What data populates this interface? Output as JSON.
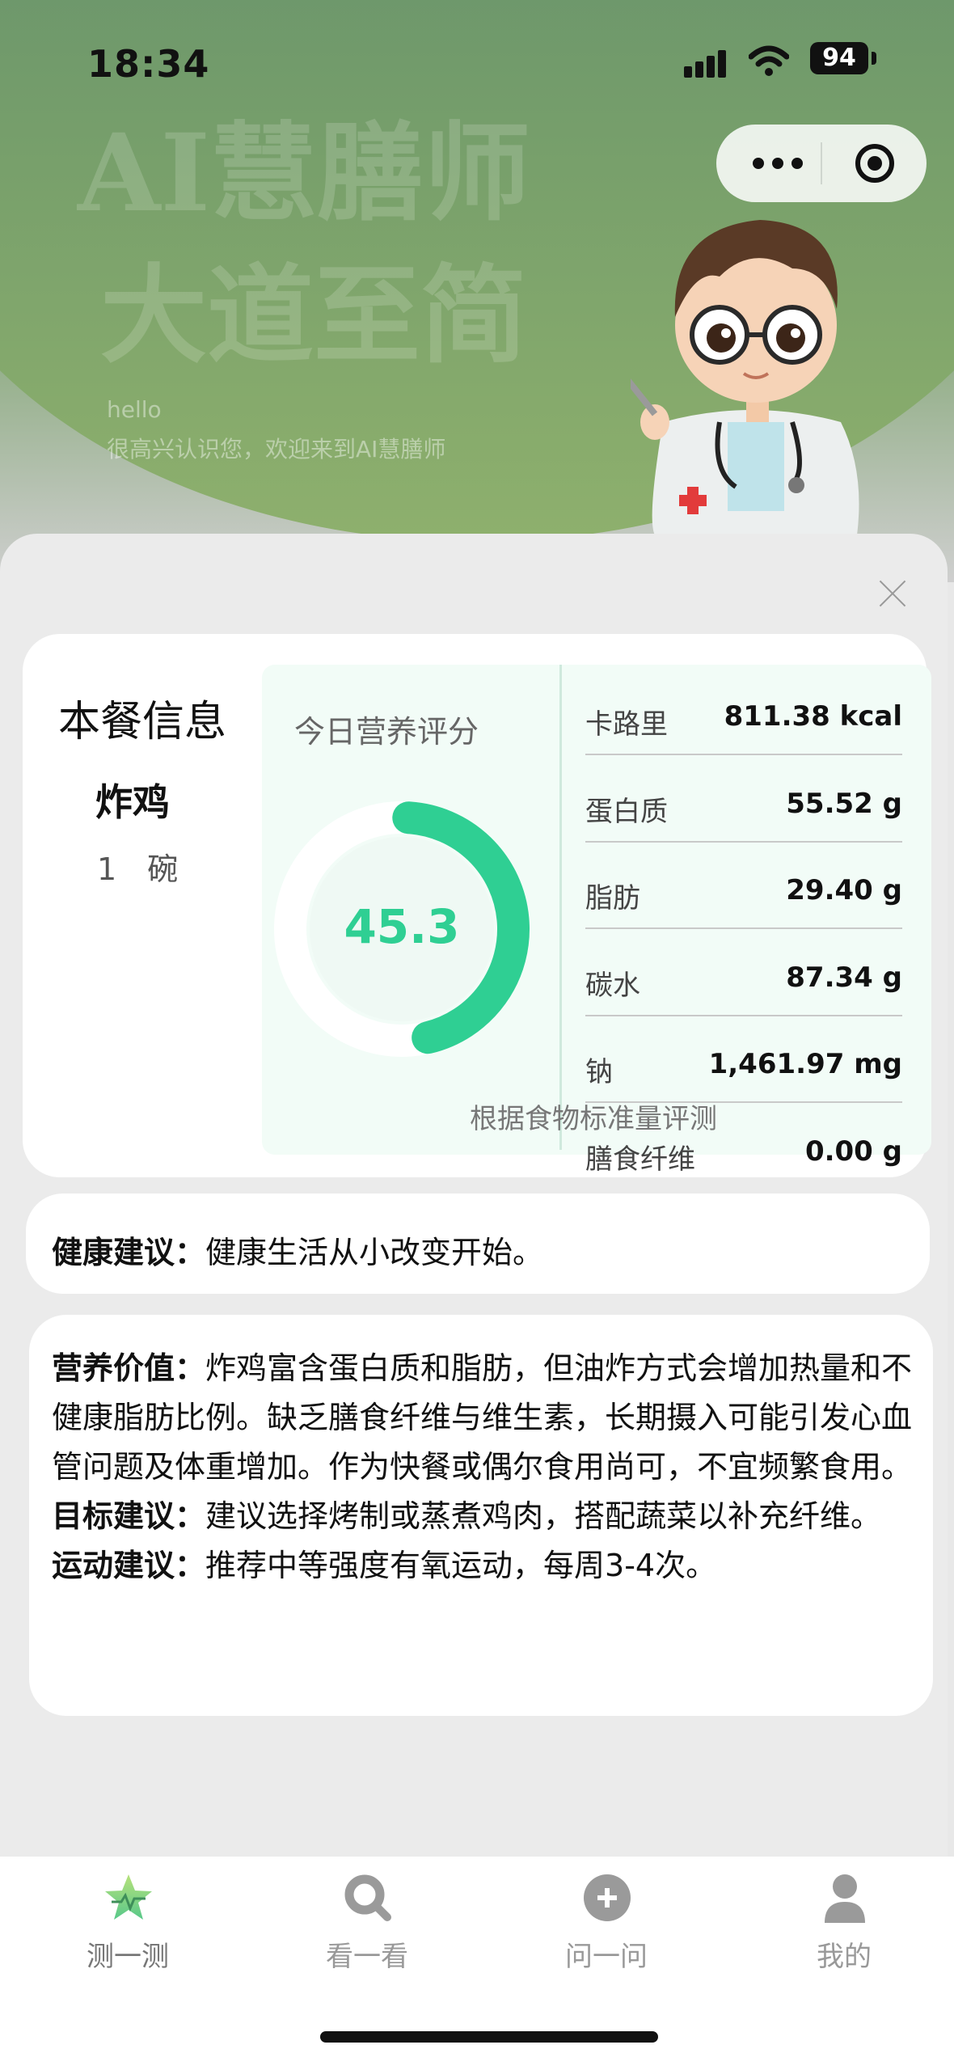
{
  "status_bar": {
    "time": "18:34",
    "battery": "94"
  },
  "hero": {
    "title_line1": "AI慧膳师",
    "title_line2": "大道至简",
    "hello": "hello",
    "welcome": "很高兴认识您，欢迎来到AI慧膳师"
  },
  "meal": {
    "title": "本餐信息",
    "food_name": "炸鸡",
    "quantity": "1 碗"
  },
  "score": {
    "label": "今日营养评分",
    "value": "45.3",
    "value_number": 45.3,
    "max": 100,
    "color": "#2fcf93",
    "note": "根据食物标准量评测"
  },
  "nutrients": [
    {
      "name": "卡路里",
      "value": "811.38 kcal"
    },
    {
      "name": "蛋白质",
      "value": "55.52 g"
    },
    {
      "name": "脂肪",
      "value": "29.40 g"
    },
    {
      "name": "碳水",
      "value": "87.34 g"
    },
    {
      "name": "钠",
      "value": "1,461.97 mg"
    },
    {
      "name": "膳食纤维",
      "value": "0.00 g"
    }
  ],
  "health_advice": {
    "label": "健康建议：",
    "text": "健康生活从小改变开始。"
  },
  "details": {
    "nutrition_label": "营养价值：",
    "nutrition_text": "炸鸡富含蛋白质和脂肪，但油炸方式会增加热量和不健康脂肪比例。缺乏膳食纤维与维生素，长期摄入可能引发心血管问题及体重增加。作为快餐或偶尔食用尚可，不宜频繁食用。",
    "goal_label": "目标建议：",
    "goal_text": "建议选择烤制或蒸煮鸡肉，搭配蔬菜以补充纤维。",
    "exercise_label": "运动建议：",
    "exercise_text": "推荐中等强度有氧运动，每周3-4次。"
  },
  "tabs": [
    {
      "label": "测一测",
      "icon": "star-pulse-icon",
      "active": true
    },
    {
      "label": "看一看",
      "icon": "magnifier-icon",
      "active": false
    },
    {
      "label": "问一问",
      "icon": "plus-circle-icon",
      "active": false
    },
    {
      "label": "我的",
      "icon": "user-icon",
      "active": false
    }
  ]
}
